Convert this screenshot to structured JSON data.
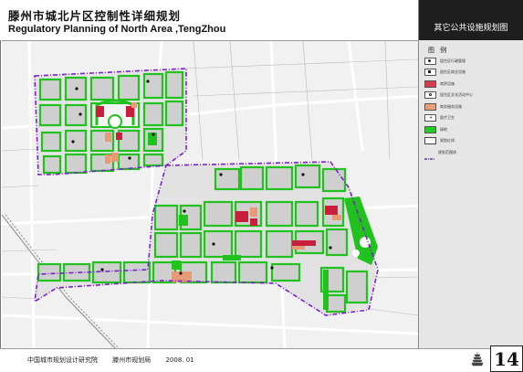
{
  "header": {
    "title_cn": "滕州市城北片区控制性详细规划",
    "title_en": "Regulatory Planning of North Area ,TengZhou"
  },
  "sidebar": {
    "sheet_title": "其它公共设施规划图",
    "legend_title": "图 例",
    "legend_items": [
      {
        "label": "居住区行政管理",
        "icon": "admin-dot",
        "color": "#ffffff"
      },
      {
        "label": "居住区商业设施",
        "icon": "commerce-dot",
        "color": "#ffffff"
      },
      {
        "label": "商贸设施",
        "icon": "trade-swatch",
        "color": "#d43b4f"
      },
      {
        "label": "居住区文化活动中心",
        "icon": "culture-dot",
        "color": "#ffffff"
      },
      {
        "label": "商务服务设施",
        "icon": "business-swatch",
        "color": "#e8a07a"
      },
      {
        "label": "医疗卫生",
        "icon": "medical-dot",
        "color": "#ffffff"
      },
      {
        "label": "绿地",
        "icon": "green-swatch",
        "color": "#28c828"
      },
      {
        "label": "规划红线",
        "icon": "redline-swatch",
        "color": "#ffffff"
      },
      {
        "label": "规划范围线",
        "icon": "boundary-line",
        "color": "#7a22c8"
      }
    ]
  },
  "footer": {
    "org1": "中国城市规划设计研究院",
    "org2": "滕州市规划局",
    "date": "2008. 01",
    "page_number": "14"
  },
  "map": {
    "colors": {
      "green": "#22c21e",
      "commercial": "#c8203c",
      "business": "#e79a73",
      "boundary": "#7a22c8",
      "road": "#ffffff",
      "block": "#d3d3d3"
    }
  }
}
